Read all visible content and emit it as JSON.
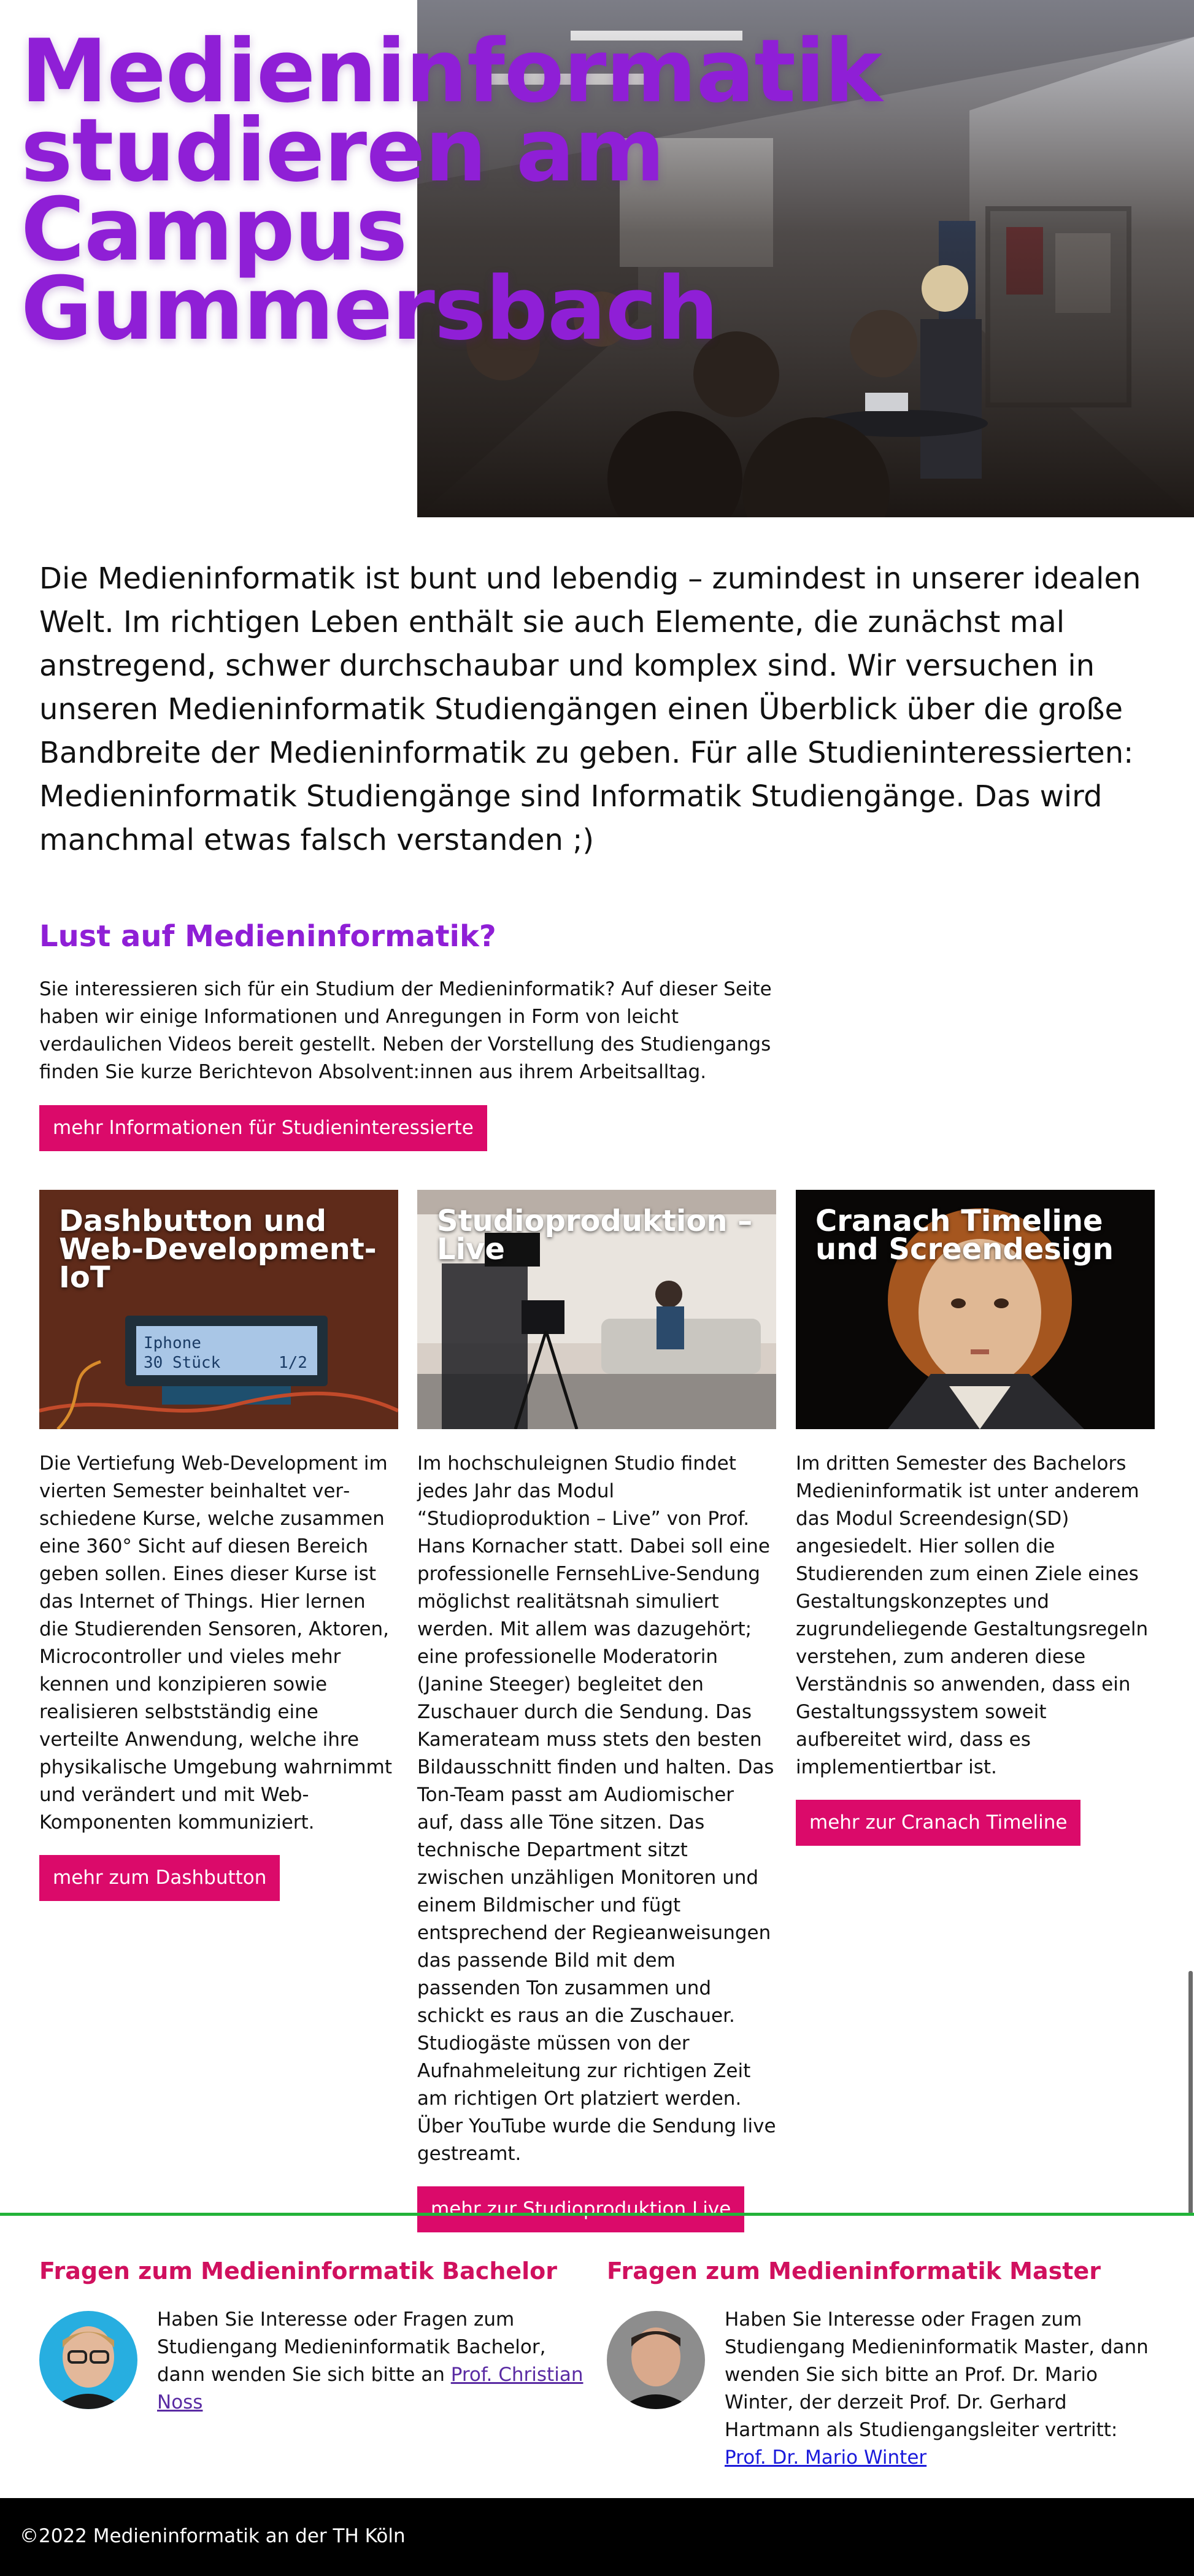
{
  "hero": {
    "title": "Medieninformatik studieren am Campus Gummersbach",
    "photo_subject": "students in a university corridor"
  },
  "intro": {
    "text": "Die Medieninformatik ist bunt und lebendig – zumindest in unserer idealen Welt. Im richtigen Leben enthält sie auch Elemente, die zunächst mal anstregend, schwer durchschaubar und komplex sind. Wir versuchen in unseren Medieninformatik Studiengängen einen Überblick über die große Bandbreite der Medieninformatik zu geben. Für alle Studieninteressierten: Medieninformatik Studiengänge sind Informatik Studiengänge. Das wird manchmal etwas falsch verstanden ;)"
  },
  "lust": {
    "heading": "Lust auf Medieninformatik?",
    "text": "Sie interessieren sich für ein Studium der Medieninformatik? Auf dieser Seite haben wir einige Informationen und Anregungen in Form von leicht verdaulichen Videos bereit gestellt. Neben der Vorstellung des Studiengangs finden Sie kurze Berichtevon Absolvent:innen aus ihrem Arbeitsalltag.",
    "button": "mehr Informationen für Studieninteressierte"
  },
  "cards": [
    {
      "title": "Dashbutton und Web-Development-IoT",
      "lcd_line1": "Iphone",
      "lcd_line2": "30 Stück",
      "lcd_page": "1/2",
      "text": "Die Vertiefung Web-Development im vierten Semester beinhaltet ver­schiedene Kurse, welche zusammen eine 360° Sicht auf diesen Bereich geben sollen. Eines dieser Kurse ist das Internet of Things. Hier lernen die Studierenden Sensoren, Aktoren, Microcontroller und vieles mehr kennen und konzipieren sowie realisieren selb­stständig eine verteilte Anwendung, welche ihre physikalische Umgebung wahrnimmt und verändert und mit Web-Komponenten kommuniziert.",
      "button": "mehr zum Dashbutton"
    },
    {
      "title": "Studioproduktion – Live",
      "text": "Im hochschuleignen Studio findet jedes Jahr das Modul “Studioproduktion – Live” von Prof. Hans Kornacher statt. Dabei soll eine professionelle Fernseh­Live-Sendung möglichst realitätsnah simuliert werden. Mit allem was dazuge­hört; eine professionelle Moderatorin (Janine Steeger) begleitet den Zuschauer durch die Sendung. Das Kamerateam muss stets den besten Bildausschnitt finden und halten. Das Ton-Team passt am Audiomischer auf, dass alle Töne sitzen. Das technische Department sitzt zwischen unzähligen Monitoren und einem Bildmischer und fügt entsprechend der Regieanweisungen das passende Bild mit dem passenden Ton zusammen und schickt es raus an die Zuschauer. Studiogäste müssen von der Aufnahmeleitung zur richtigen Zeit am richtigen Ort platziert werden. Über YouTube wurde die Sendung live gestreamt.",
      "button": "mehr zur Studioproduktion Live"
    },
    {
      "title": "Cranach Timeline und Screendesign",
      "text": "Im dritten Semester des Bachelors Medieninformatik ist unter anderem das Modul Screendesign(SD) angesiedelt. Hier sollen die Studierenden zum einen Ziele eines Gestaltungskonzeptes und zugrundeliegende Gestaltungsregeln verstehen, zum anderen diese Verständnis so anwenden, dass ein Gestaltungssystem soweit aufbereitet wird, dass es implementiertbar ist.",
      "button": "mehr zur Cranach Timeline"
    }
  ],
  "contacts": [
    {
      "heading": "Fragen zum Medieninformatik Bachelor",
      "text": "Haben Sie Interesse oder Fragen zum Studiengang Medieninformatik Bachelor, dann wenden Sie sich bitte an ",
      "link": "Prof. Christian Noss"
    },
    {
      "heading": "Fragen zum Medieninformatik Master",
      "text": "Haben Sie Interesse oder Fragen zum Studiengang Medieninformatik Master, dann wenden Sie sich bitte an Prof. Dr. Mario Winter, der derzeit Prof. Dr. Gerhard Hartmann als Studiengangsleiter vertritt: ",
      "link": "Prof. Dr. Mario Winter"
    }
  ],
  "footer": {
    "text": "©2022 Medieninformatik an der TH Köln"
  },
  "colors": {
    "purple_accent": "#8f1fd6",
    "button_pink": "#db0a6a",
    "contact_heading": "#d0105e",
    "divider_green": "#22b339",
    "footer_bg": "#000000"
  }
}
